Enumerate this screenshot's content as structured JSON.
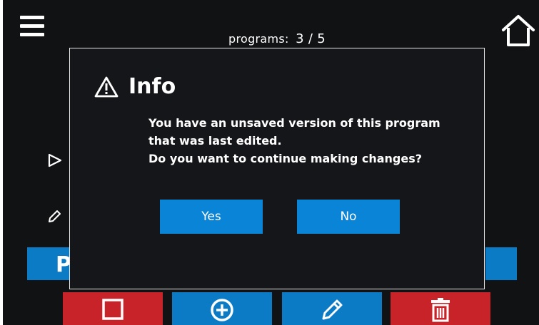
{
  "header": {
    "programs_label": "programs:",
    "programs_count": "3 / 5",
    "menu_icon": "hamburger-menu-icon",
    "home_icon": "home-icon"
  },
  "list": {
    "row_icons": [
      "play-icon",
      "pencil-icon"
    ],
    "band_letter": "P"
  },
  "dialog": {
    "icon": "warning-triangle-icon",
    "title": "Info",
    "message_lines": [
      "You have an unsaved version of this program",
      "that was last edited.",
      "Do you want to continue making changes?"
    ],
    "yes_label": "Yes",
    "no_label": "No"
  },
  "bottom_bar": {
    "buttons": [
      {
        "icon": "stop-square-icon",
        "color": "#c9232a"
      },
      {
        "icon": "plus-circle-icon",
        "color": "#0a7bc4"
      },
      {
        "icon": "pencil-icon",
        "color": "#0a7bc4"
      },
      {
        "icon": "trash-icon",
        "color": "#c9232a"
      }
    ]
  },
  "colors": {
    "background": "#111214",
    "accent_blue": "#0a84d6",
    "danger_red": "#c9232a",
    "dialog_border": "#e8e8e8"
  }
}
